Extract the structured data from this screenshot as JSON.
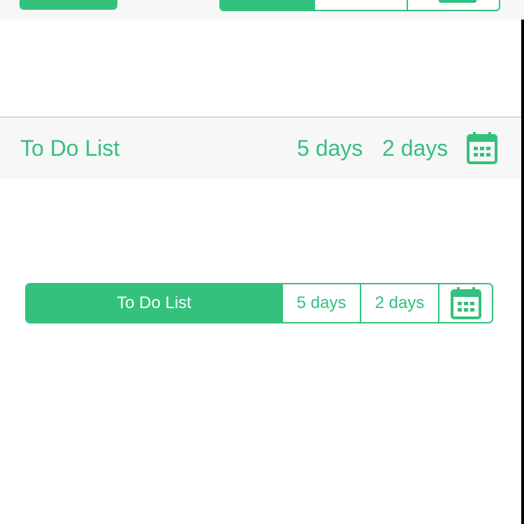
{
  "colors": {
    "accent": "#33c17d",
    "nav_background": "#f7f7f7",
    "separator": "#b5b5b5",
    "background": "#ffffff"
  },
  "nav": {
    "title": "To Do List",
    "five_days": "5 days",
    "two_days": "2 days",
    "calendar_icon": "calendar-icon"
  },
  "segmented": {
    "todo": "To Do List",
    "five_days": "5 days",
    "two_days": "2 days",
    "calendar_icon": "calendar-icon",
    "selected": "To Do List"
  }
}
